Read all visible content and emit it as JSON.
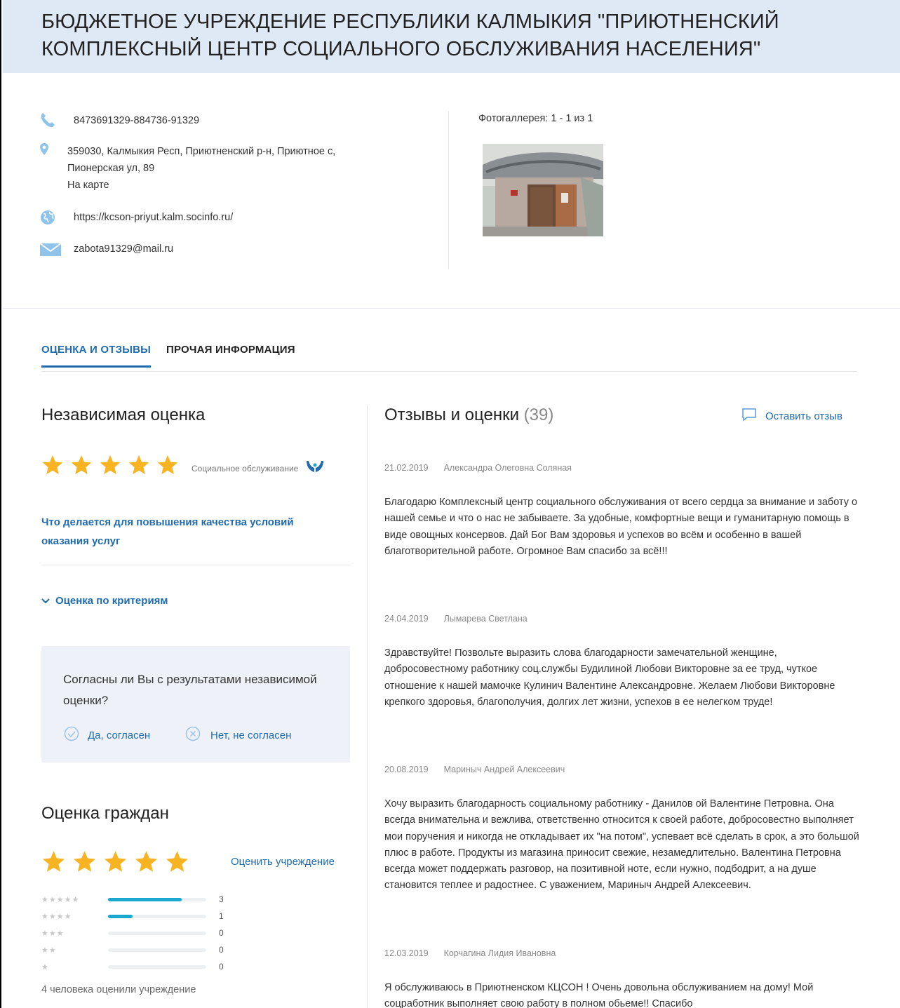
{
  "header": {
    "title": "БЮДЖЕТНОЕ УЧРЕЖДЕНИЕ РЕСПУБЛИКИ КАЛМЫКИЯ \"ПРИЮТНЕНСКИЙ КОМПЛЕКСНЫЙ ЦЕНТР СОЦИАЛЬНОГО ОБСЛУЖИВАНИЯ НАСЕЛЕНИЯ\""
  },
  "contacts": {
    "phone": "8473691329-884736-91329",
    "address_line1": "359030, Калмыкия Респ, Приютненский р-н, Приютное с,",
    "address_line2": "Пионерская ул, 89",
    "map_link": "На карте",
    "website": "https://kcson-priyut.kalm.socinfo.ru/",
    "email": "zabota91329@mail.ru"
  },
  "gallery": {
    "caption": "Фотогаллерея: 1 - 1 из 1"
  },
  "tabs": [
    {
      "label": "ОЦЕНКА И ОТЗЫВЫ",
      "active": true
    },
    {
      "label": "ПРОЧАЯ ИНФОРМАЦИЯ",
      "active": false
    }
  ],
  "independent": {
    "title": "Независимая оценка",
    "rating": 5,
    "category": "Социальное обслуживание",
    "improve_link": "Что делается для повышения качества условий оказания услуг",
    "criteria_link": "Оценка по критериям"
  },
  "agree": {
    "question": "Согласны ли Вы с результатами независимой оценки?",
    "yes": "Да, согласен",
    "no": "Нет, не согласен"
  },
  "citizens": {
    "title": "Оценка граждан",
    "rating": 5,
    "rate_link": "Оценить учреждение",
    "distribution": [
      {
        "stars": 5,
        "count": "3",
        "fraction": 0.75
      },
      {
        "stars": 4,
        "count": "1",
        "fraction": 0.25
      },
      {
        "stars": 3,
        "count": "0",
        "fraction": 0
      },
      {
        "stars": 2,
        "count": "0",
        "fraction": 0
      },
      {
        "stars": 1,
        "count": "0",
        "fraction": 0
      }
    ],
    "rated_text": "4 человека оценили учреждение"
  },
  "reviews": {
    "title": "Отзывы и оценки",
    "count": "(39)",
    "leave_link": "Оставить отзыв",
    "items": [
      {
        "date": "21.02.2019",
        "author": "Александра Олеговна Соляная",
        "text": "Благодарю Комплексный центр социального обслуживания от всего сердца за внимание и заботу о нашей семье и что о нас не забываете. За удобные, комфортные вещи и гуманитарную помощь в виде овощных консервов. Дай Бог Вам здоровья и успехов во всём и особенно в вашей благотворительной работе. Огромное Вам спасибо за всё!!!"
      },
      {
        "date": "24.04.2019",
        "author": "Лымарева Светлана",
        "text": "Здравствуйте! Позвольте выразить слова благодарности замечательной женщине, добросовестному работнику соц.службы Будилиной Любови Викторовне за ее труд, чуткое отношение к нашей мамочке Кулинич Валентине Александровне. Желаем Любови Викторовне крепкого здоровья, благополучия, долгих лет жизни, успехов в ее нелегком труде!"
      },
      {
        "date": "20.08.2019",
        "author": "Мариныч Андрей Алексеевич",
        "text": "Хочу выразить благодарность социальному работнику - Данилов ой Валентине Петровна. Она всегда внимательна и вежлива, ответственно относится к своей работе, добросовестно выполняет мои поручения и никогда не откладывает их \"на потом\", успевает всё сделать в срок, а это большой плюс в работе. Продукты из магазина приносит свежие, незамедлительно. Валентина Петровна всегда может поддержать разговор, на позитивной ноте, если нужно, подбодрит, а на душе становится теплее и радостнее. С уважением, Мариныч Андрей Алексеевич."
      },
      {
        "date": "12.03.2019",
        "author": "Корчагина Лидия Ивановна",
        "text": "Я обслуживаюсь в Приютненском КЦСОН ! Очень довольна обслуживанием на дому! Мой соцработник выполняет свою работу в полном обьеме!! Спасибо"
      }
    ]
  },
  "colors": {
    "accent": "#1f6bb0",
    "star": "#f7b321",
    "header_bg": "#dfe9f5",
    "bar": "#19a8d0"
  }
}
